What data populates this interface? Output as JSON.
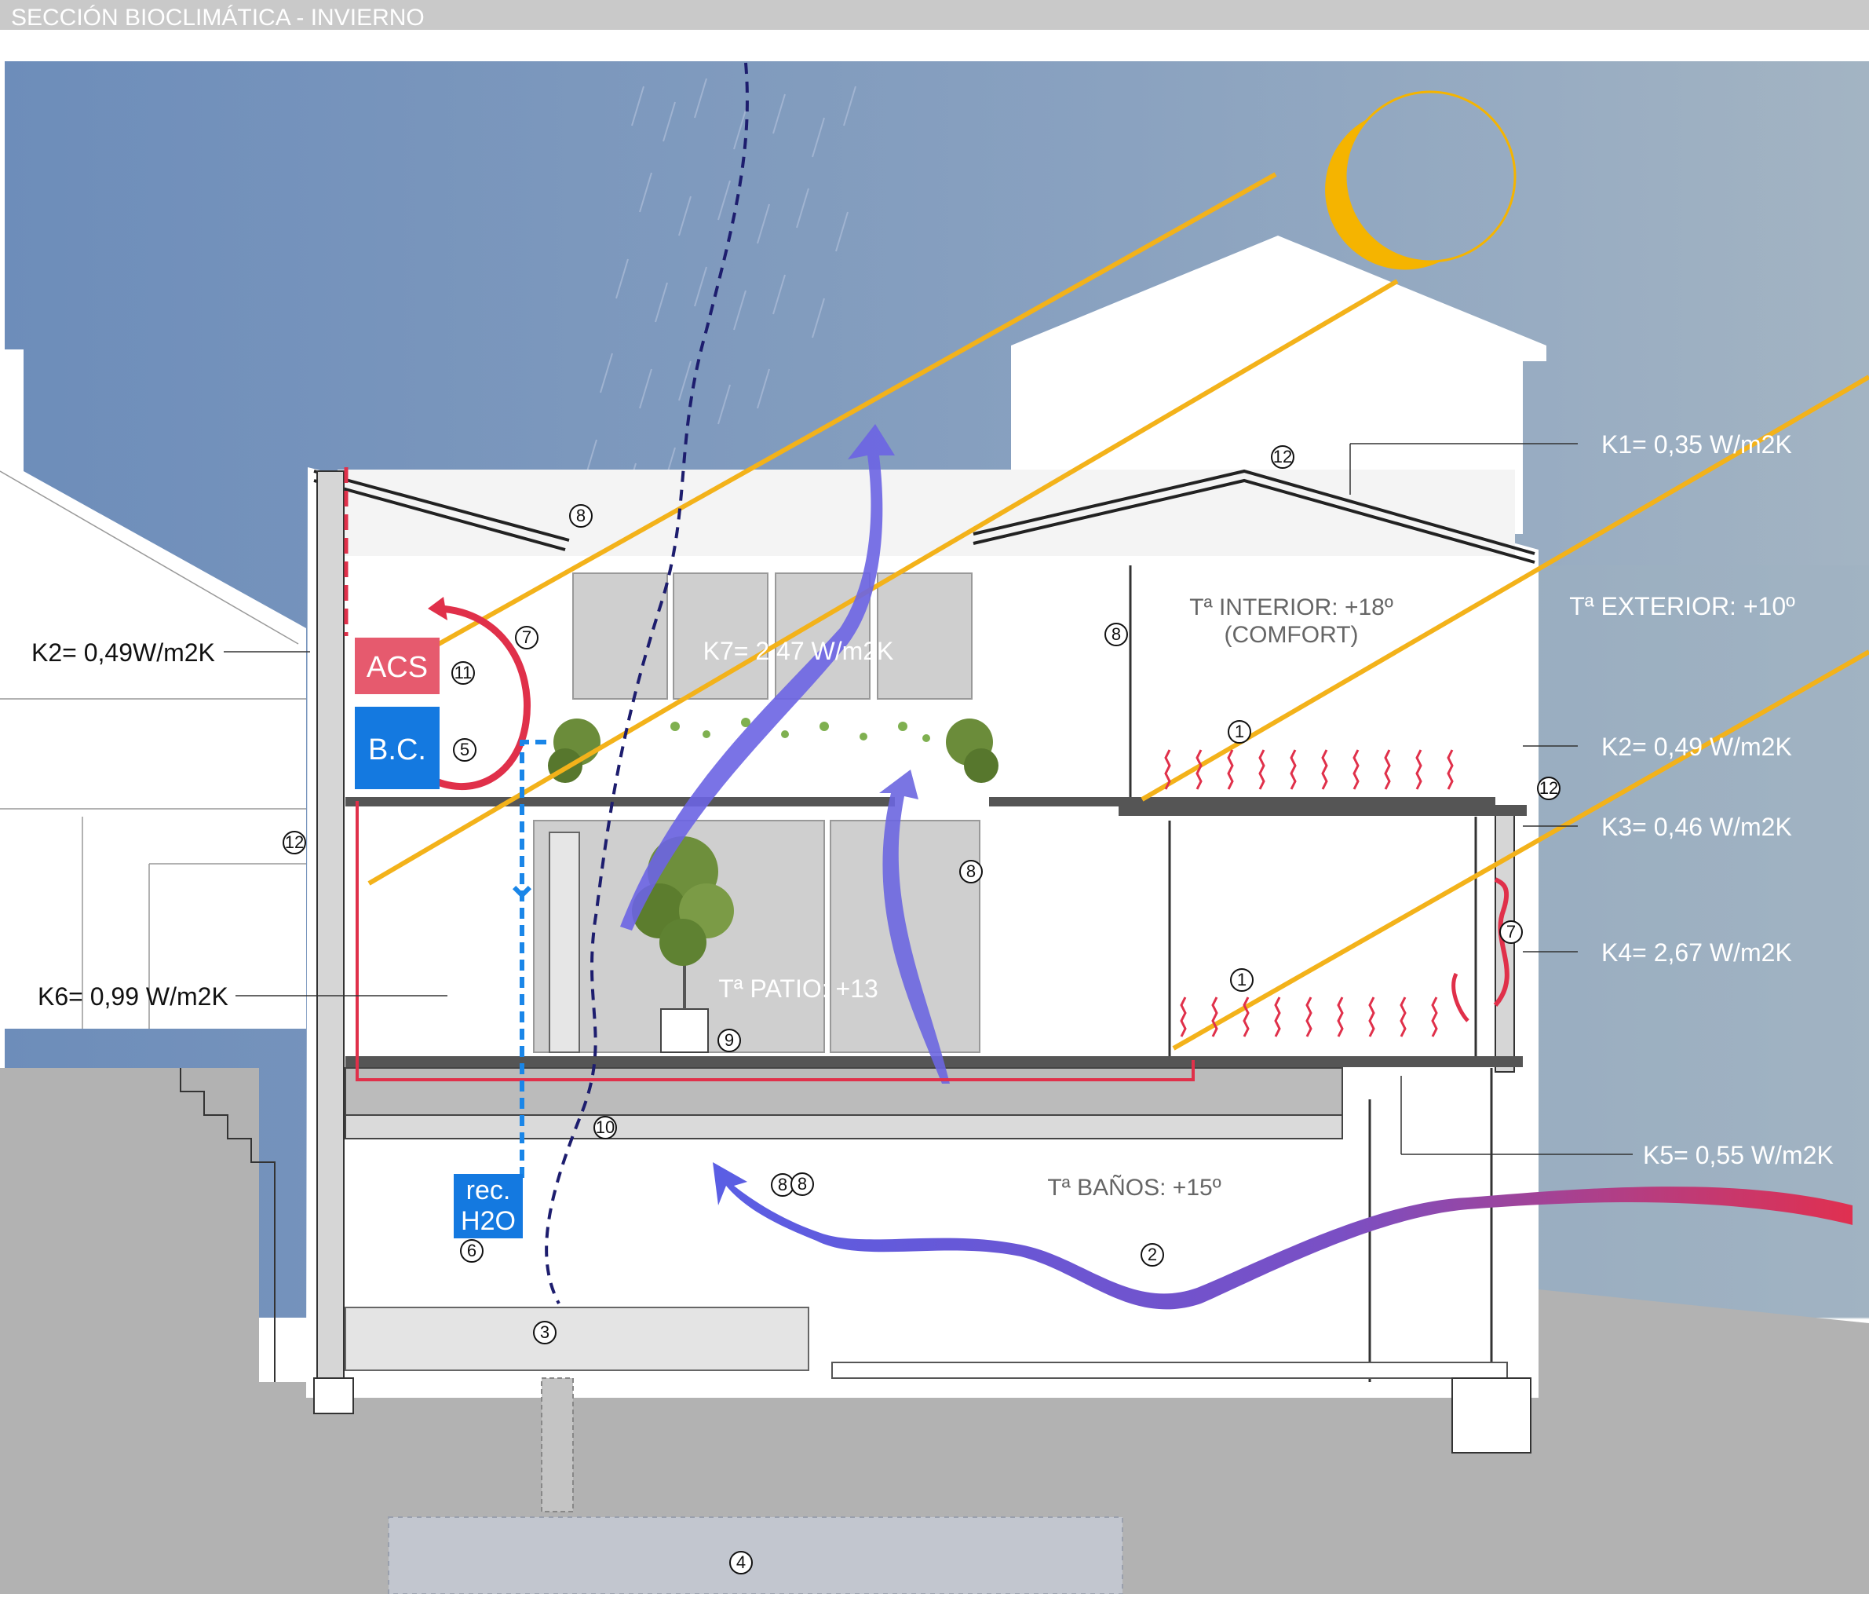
{
  "header": {
    "title": "SECCIÓN BIOCLIMÁTICA - INVIERNO"
  },
  "colors": {
    "sky_top": "#6f8fb8",
    "sky_right": "#9cb0c0",
    "ground": "#b4b4b4",
    "sun": "#f5b400",
    "sun_ray": "#f3b21a",
    "heat_red": "#e0304a",
    "air_purple": "#6f62dd",
    "water_blue": "#1a86e8",
    "acs_box": "#e65a6e",
    "bc_box": "#1479e0",
    "rec_box": "#1479e0"
  },
  "labels": {
    "k1": "K1= 0,35 W/m2K",
    "k2_left": "K2= 0,49W/m2K",
    "k2_right": "K2= 0,49 W/m2K",
    "k3": "K3= 0,46 W/m2K",
    "k4": "K4= 2,67 W/m2K",
    "k5": "K5= 0,55 W/m2K",
    "k6": "K6= 0,99 W/m2K",
    "k7": "K7= 2,47 W/m2K",
    "t_interior": "Tª INTERIOR: +18º",
    "t_interior_note": "(COMFORT)",
    "t_exterior": "Tª EXTERIOR: +10º",
    "t_patio": "Tª PATIO: +13",
    "t_banos": "Tª BAÑOS: +15º"
  },
  "boxes": {
    "acs": "ACS",
    "bc": "B.C.",
    "rec_line1": "rec.",
    "rec_line2": "H2O"
  },
  "markers": [
    "1",
    "1",
    "2",
    "3",
    "4",
    "5",
    "6",
    "7",
    "7",
    "8",
    "8",
    "8",
    "8",
    "8",
    "9",
    "10",
    "11",
    "12",
    "12",
    "12"
  ]
}
